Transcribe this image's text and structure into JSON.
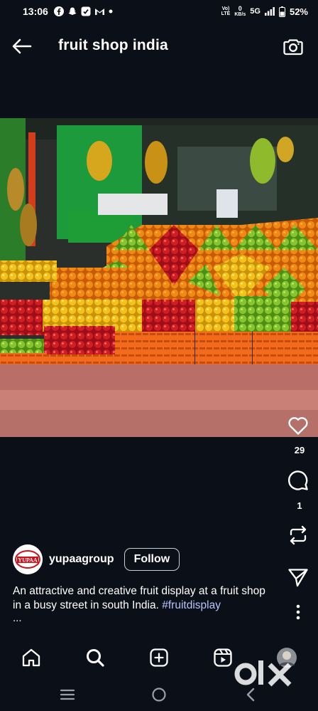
{
  "status_bar": {
    "time": "13:06",
    "network_top": "Vo)",
    "network_bottom": "LTE",
    "speed_value": "0",
    "speed_unit": "KB/s",
    "signal_label": "5G",
    "battery": "52%",
    "icons_left": [
      "facebook-icon",
      "snapchat-icon",
      "app-icon",
      "gmail-icon",
      "dot-icon"
    ]
  },
  "header": {
    "title": "fruit shop india",
    "back_icon": "arrow-left-icon",
    "camera_icon": "camera-icon"
  },
  "post": {
    "like_count": "29",
    "comment_count": "1",
    "author": "yupaagroup",
    "avatar_text": "YUPAA",
    "follow_label": "Follow",
    "caption_text": "An attractive and creative fruit display at a fruit shop in a busy street in south India.  ",
    "caption_hashtag": "#fruitdisplay",
    "caption_more": "..."
  },
  "bottom_nav": {
    "items": [
      "home-icon",
      "search-icon",
      "create-icon",
      "reels-icon",
      "profile-avatar"
    ]
  },
  "watermark": "olx",
  "colors": {
    "background": "#0b0f17",
    "hashtag": "#b9c6ff",
    "crate": "#f26a1b"
  }
}
